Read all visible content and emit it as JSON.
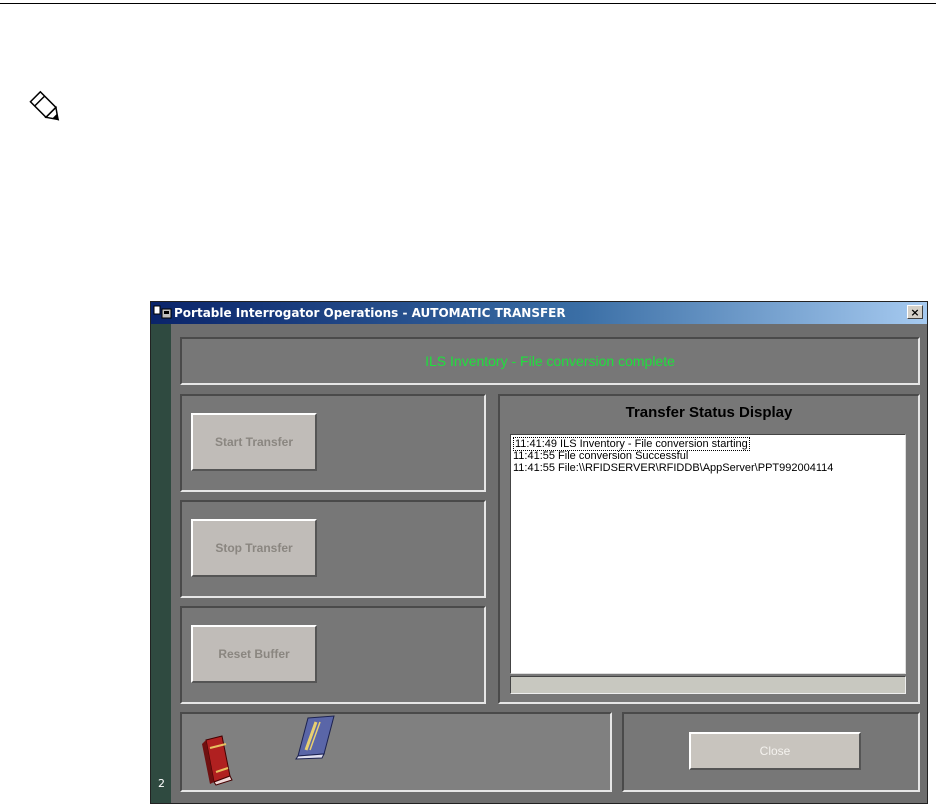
{
  "window": {
    "title": "Portable Interrogator Operations  -  AUTOMATIC TRANSFER",
    "close_glyph": "×",
    "strip_number": "2"
  },
  "header": {
    "message": "ILS Inventory - File conversion complete",
    "message_color": "#1ee03c"
  },
  "buttons": {
    "start_transfer": "Start Transfer",
    "stop_transfer": "Stop Transfer",
    "reset_buffer": "Reset Buffer",
    "close": "Close"
  },
  "status": {
    "title": "Transfer Status Display",
    "lines": [
      "11:41:49 ILS Inventory - File conversion starting",
      "11:41:55 File conversion Successful",
      "11:41:55 File:\\\\RFIDSERVER\\RFIDDB\\AppServer\\PPT992004114"
    ]
  },
  "icons": {
    "note": "pencil-note-icon",
    "app": "app-window-icon",
    "book_red": "red-book-icon",
    "book_blue": "blue-book-icon"
  }
}
